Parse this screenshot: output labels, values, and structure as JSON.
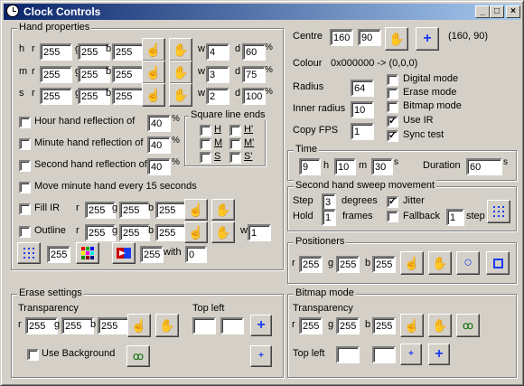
{
  "window": {
    "title": "Clock Controls",
    "minimize": "_",
    "maximize": "□",
    "close": "×"
  },
  "hand_properties": {
    "label": "Hand properties",
    "rows": [
      {
        "name": "h",
        "r": "255",
        "g": "255",
        "b": "255",
        "w": "4",
        "d": "60"
      },
      {
        "name": "m",
        "r": "255",
        "g": "255",
        "b": "255",
        "w": "3",
        "d": "75"
      },
      {
        "name": "s",
        "r": "255",
        "g": "255",
        "b": "255",
        "w": "2",
        "d": "100"
      }
    ],
    "r": "r",
    "g": "g",
    "b": "b",
    "w": "w",
    "d": "d",
    "pct": "%",
    "hour_reflection": "Hour hand reflection of",
    "hour_reflection_value": "40",
    "minute_reflection": "Minute hand reflection of",
    "minute_reflection_value": "40",
    "second_reflection": "Second hand reflection of",
    "second_reflection_value": "40",
    "square_line_ends": "Square line ends",
    "sq": {
      "H": "H",
      "Hp": "H'",
      "M": "M",
      "Mp": "M'",
      "S": "S",
      "Sp": "S'"
    },
    "move_minute": "Move minute hand every 15 seconds",
    "fill_ir": "Fill IR",
    "fill_r": "255",
    "fill_g": "255",
    "fill_b": "255",
    "outline": "Outline",
    "outline_r": "255",
    "outline_g": "255",
    "outline_b": "255",
    "outline_w": "1",
    "bottom_value1": "255",
    "bottom_value2": "255",
    "with": "with",
    "with_value": "0"
  },
  "erase": {
    "label": "Erase settings",
    "transparency": "Transparency",
    "r": "255",
    "g": "255",
    "b": "255",
    "top_left": "Top left",
    "tl_x": "",
    "tl_y": "",
    "use_background": "Use Background"
  },
  "centre": {
    "label": "Centre",
    "x": "160",
    "y": "90",
    "readout": "(160, 90)"
  },
  "colour": {
    "label": "Colour",
    "value": "0x000000 -> (0,0,0)"
  },
  "radius": {
    "label": "Radius",
    "value": "64"
  },
  "inner_radius": {
    "label": "Inner radius",
    "value": "10"
  },
  "copy_fps": {
    "label": "Copy FPS",
    "value": "1"
  },
  "options": {
    "digital_mode": "Digital mode",
    "erase_mode": "Erase mode",
    "bitmap_mode": "Bitmap mode",
    "use_ir": "Use IR",
    "sync_test": "Sync test"
  },
  "time": {
    "label": "Time",
    "h": "9",
    "h_lbl": "h",
    "m": "10",
    "m_lbl": "m",
    "s": "30",
    "s_lbl": "s",
    "duration_label": "Duration",
    "duration": "60",
    "dur_lbl": "s"
  },
  "sweep": {
    "label": "Second hand sweep movement",
    "step_label": "Step",
    "step": "3",
    "degrees": "degrees",
    "hold_label": "Hold",
    "hold": "1",
    "frames": "frames",
    "jitter": "Jitter",
    "fallback": "Fallback",
    "fallback_value": "1",
    "step_word": "step"
  },
  "positioners": {
    "label": "Positioners",
    "r": "255",
    "g": "255",
    "b": "255"
  },
  "bitmap_mode": {
    "label": "Bitmap mode",
    "transparency": "Transparency",
    "r": "255",
    "g": "255",
    "b": "255",
    "top_left": "Top left",
    "tl_x": "",
    "tl_y": ""
  }
}
